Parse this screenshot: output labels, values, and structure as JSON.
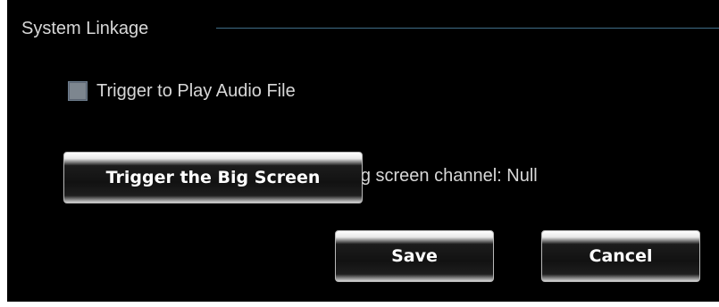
{
  "group": {
    "title": "System Linkage"
  },
  "trigger_audio": {
    "label": "Trigger to Play Audio File",
    "checked": false
  },
  "big_screen": {
    "button_label": "Trigger the Big Screen",
    "channel_text": "Current big screen channel: Null"
  },
  "actions": {
    "save_label": "Save",
    "cancel_label": "Cancel"
  },
  "colors": {
    "panel_background": "#000000",
    "text": "#d8d8d8",
    "group_line": "#3f6d88"
  }
}
